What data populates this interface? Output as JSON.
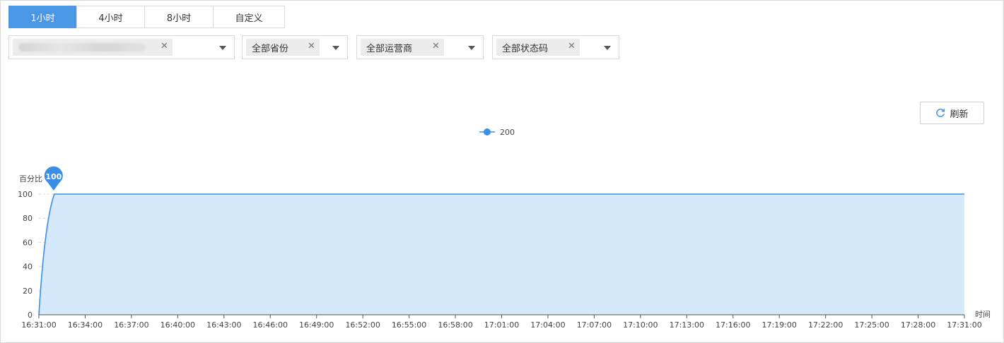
{
  "time_tabs": [
    {
      "label": "1小时",
      "active": true
    },
    {
      "label": "4小时",
      "active": false
    },
    {
      "label": "8小时",
      "active": false
    },
    {
      "label": "自定义",
      "active": false
    }
  ],
  "filters": {
    "domain": {
      "value": ""
    },
    "province": {
      "value": "全部省份"
    },
    "carrier": {
      "value": "全部运营商"
    },
    "status_code": {
      "value": "全部状态码"
    }
  },
  "refresh_label": "刷新",
  "colors": {
    "accent": "#4a97e6",
    "line": "#3a8ee6",
    "area": "#d6e8fb"
  },
  "icons": [
    "close-icon",
    "chevron-down-icon",
    "refresh-icon"
  ],
  "chart_data": {
    "type": "area",
    "ylabel": "百分比",
    "xlabel": "时间",
    "ylim": [
      0,
      100
    ],
    "yticks": [
      0,
      20,
      40,
      60,
      80,
      100
    ],
    "x_ticks": [
      "16:31:00",
      "16:34:00",
      "16:37:00",
      "16:40:00",
      "16:43:00",
      "16:46:00",
      "16:49:00",
      "16:52:00",
      "16:55:00",
      "16:58:00",
      "17:01:00",
      "17:04:00",
      "17:07:00",
      "17:10:00",
      "17:13:00",
      "17:16:00",
      "17:19:00",
      "17:22:00",
      "17:25:00",
      "17:28:00",
      "17:31:00"
    ],
    "series": [
      {
        "name": "200",
        "x": [
          "16:31:00",
          "16:32:00",
          "16:33:00",
          "17:31:00"
        ],
        "values": [
          0,
          100,
          100,
          100
        ]
      }
    ],
    "markers": [
      {
        "label": "100",
        "x": "16:32:00",
        "value": 100
      }
    ],
    "legend_position": "top-center",
    "grid": "horizontal dashed"
  }
}
